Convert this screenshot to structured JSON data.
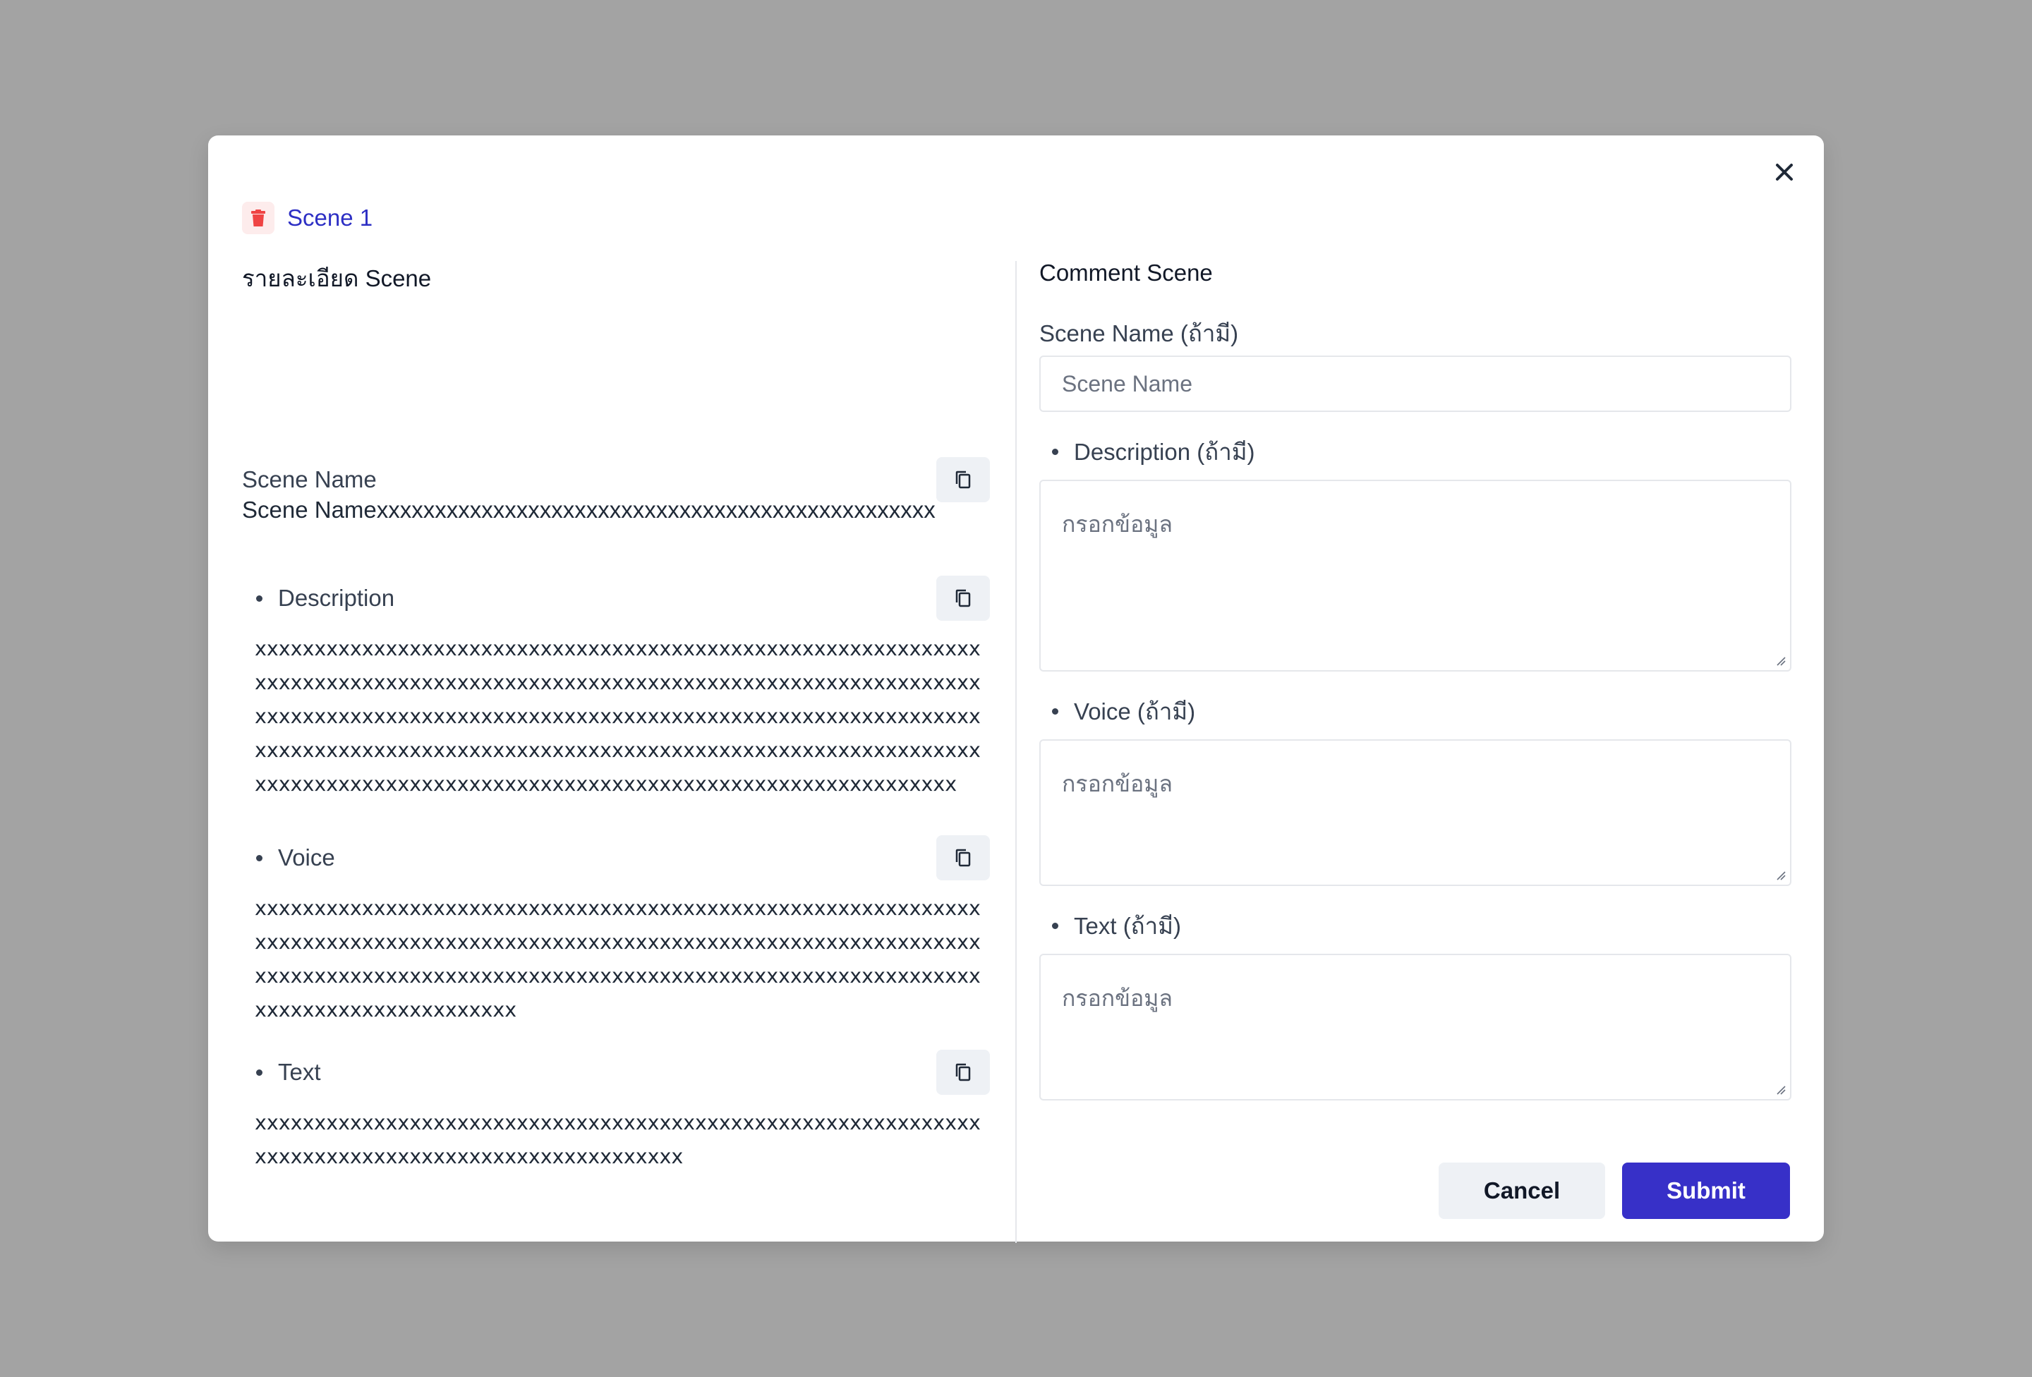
{
  "modal": {
    "title": "Scene 1",
    "close_label": "×"
  },
  "left": {
    "section_title": "รายละเอียด Scene",
    "scene_name_label": "Scene Name",
    "scene_name_value": "Scene Namexxxxxxxxxxxxxxxxxxxxxxxxxxxxxxxxxxxxxxxxxxxxxxxx",
    "description_label": "Description",
    "description_value": "xxxxxxxxxxxxxxxxxxxxxxxxxxxxxxxxxxxxxxxxxxxxxxxxxxxxxxxxxxxxxxxxxxxxxxxxxxxxxxxxxxxxxxxxxxxxxxxxxxxxxxxxxxxxxxxxxxxxxxxxxxxxxxxxxxxxxxxxxxxxxxxxxxxxxxxxxxxxxxxxxxxxxxxxxxxxxxxxxxxxxxxxxxxxxxxxxxxxxxxxxxxxxxxxxxxxxxxxxxxxxxxxxxxxxxxxxxxxxxxxxxxxxxxxxxxxxxxxxxxxxxxxxxxxxxxxxxxxxxxxxxxxxxxxxxxxxxxxxxxxxxx",
    "voice_label": "Voice",
    "voice_value": "xxxxxxxxxxxxxxxxxxxxxxxxxxxxxxxxxxxxxxxxxxxxxxxxxxxxxxxxxxxxxxxxxxxxxxxxxxxxxxxxxxxxxxxxxxxxxxxxxxxxxxxxxxxxxxxxxxxxxxxxxxxxxxxxxxxxxxxxxxxxxxxxxxxxxxxxxxxxxxxxxxxxxxxxxxxxxxxxxxxxxxxxxxxxxxxxxxxxxxxxxxxxx",
    "text_label": "Text",
    "text_value": "xxxxxxxxxxxxxxxxxxxxxxxxxxxxxxxxxxxxxxxxxxxxxxxxxxxxxxxxxxxxxxxxxxxxxxxxxxxxxxxxxxxxxxxxxxxxxxxxx"
  },
  "right": {
    "section_title": "Comment Scene",
    "scene_name_label": "Scene Name (ถ้ามี)",
    "scene_name_placeholder": "Scene Name",
    "description_label": "Description (ถ้ามี)",
    "voice_label": "Voice (ถ้ามี)",
    "text_label": "Text (ถ้ามี)",
    "textarea_placeholder": "กรอกข้อมูล"
  },
  "footer": {
    "cancel_label": "Cancel",
    "submit_label": "Submit"
  },
  "colors": {
    "accent": "#3730c8",
    "title_blue": "#2d2fc4",
    "danger": "#ef4444",
    "overlay": "#a3a3a3"
  },
  "icons": {
    "close": "close-icon",
    "trash": "trash-icon",
    "copy": "copy-icon"
  }
}
